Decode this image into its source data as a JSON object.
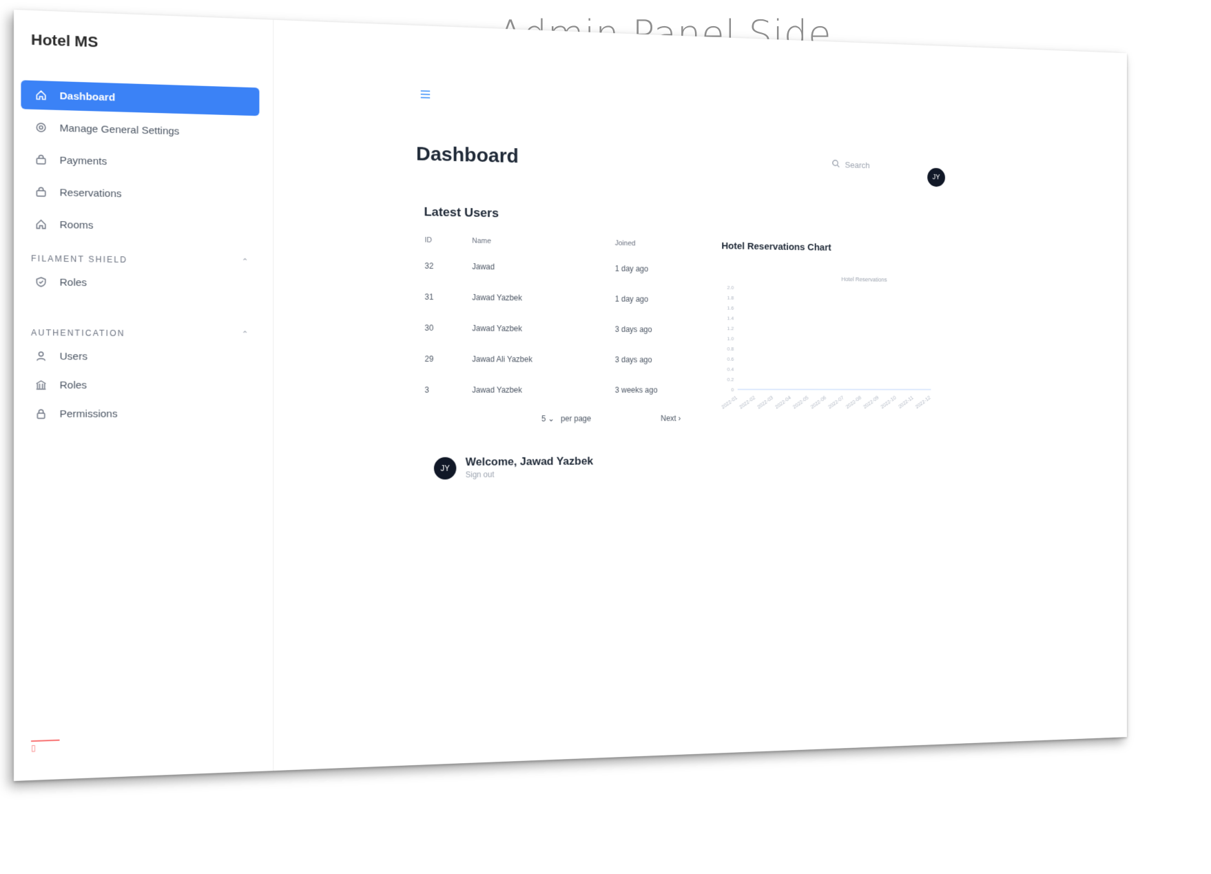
{
  "page_heading": "Admin Panel Side",
  "app": {
    "brand": "Hotel MS"
  },
  "sidebar": {
    "items": [
      {
        "label": "Dashboard",
        "icon": "home-icon",
        "active": true
      },
      {
        "label": "Manage General Settings",
        "icon": "settings-icon"
      },
      {
        "label": "Payments",
        "icon": "bag-icon"
      },
      {
        "label": "Reservations",
        "icon": "bag-icon"
      },
      {
        "label": "Rooms",
        "icon": "home-icon"
      }
    ],
    "groups": [
      {
        "title": "FILAMENT SHIELD",
        "items": [
          {
            "label": "Roles",
            "icon": "shield-icon"
          }
        ]
      },
      {
        "title": "AUTHENTICATION",
        "items": [
          {
            "label": "Users",
            "icon": "user-icon"
          },
          {
            "label": "Roles",
            "icon": "building-icon"
          },
          {
            "label": "Permissions",
            "icon": "lock-icon"
          }
        ]
      }
    ]
  },
  "header": {
    "title": "Dashboard",
    "search_placeholder": "Search",
    "avatar_initials": "JY"
  },
  "latest_users": {
    "title": "Latest Users",
    "columns": [
      "ID",
      "Name",
      "Joined"
    ],
    "rows": [
      [
        "32",
        "Jawad",
        "1 day ago"
      ],
      [
        "31",
        "Jawad Yazbek",
        "1 day ago"
      ],
      [
        "30",
        "Jawad Yazbek",
        "3 days ago"
      ],
      [
        "29",
        "Jawad Ali Yazbek",
        "3 days ago"
      ],
      [
        "3",
        "Jawad Yazbek",
        "3 weeks ago"
      ]
    ],
    "per_page_value": "5",
    "per_page_label": "per page",
    "next_label": "Next"
  },
  "welcome": {
    "text": "Welcome, Jawad Yazbek",
    "sign_out": "Sign out",
    "avatar_initials": "JY"
  },
  "chart_data": {
    "type": "line",
    "title": "Hotel Reservations Chart",
    "series": [
      {
        "name": "Hotel Reservations",
        "values": [
          0,
          0,
          0,
          0,
          0,
          0,
          0,
          0,
          0,
          0,
          0,
          0
        ]
      }
    ],
    "categories": [
      "2022-01",
      "2022-02",
      "2022-03",
      "2022-04",
      "2022-05",
      "2022-06",
      "2022-07",
      "2022-08",
      "2022-09",
      "2022-10",
      "2022-11",
      "2022-12"
    ],
    "yticks": [
      "0",
      "0.2",
      "0.4",
      "0.6",
      "0.8",
      "1.0",
      "1.2",
      "1.4",
      "1.6",
      "1.8",
      "2.0"
    ],
    "ylim": [
      0,
      2
    ],
    "grid": false,
    "legend": "top-center",
    "color": "#3b82f6"
  },
  "colors": {
    "accent": "#3b82f6",
    "avatar": "#111827"
  }
}
